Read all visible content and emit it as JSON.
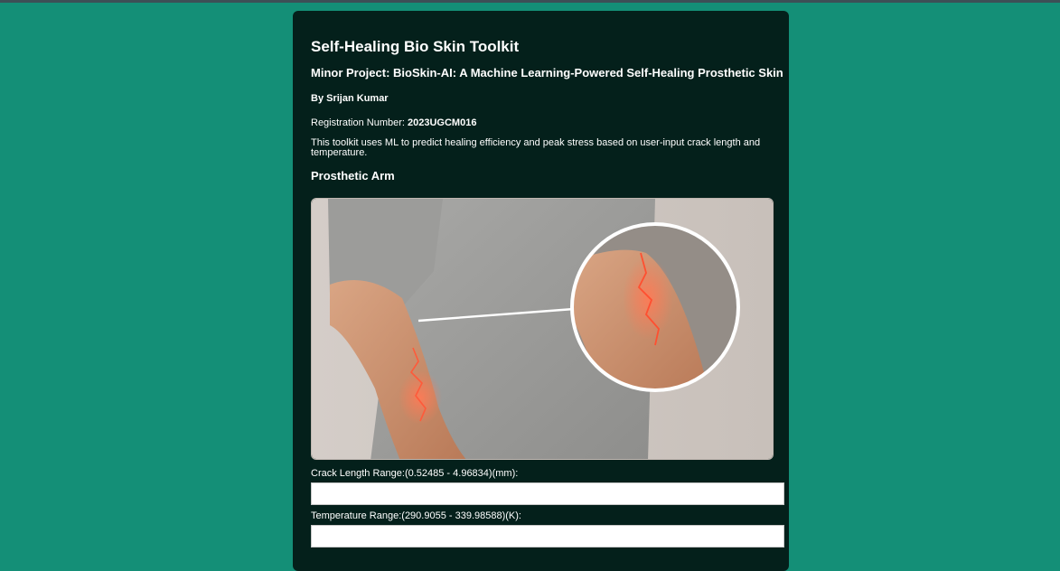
{
  "header": {
    "title": "Self-Healing Bio Skin Toolkit",
    "subtitle": "Minor Project: BioSkin-AI: A Machine Learning-Powered Self-Healing Prosthetic Skin",
    "author_prefix": "By",
    "author_name": "Srijan Kumar",
    "registration_label": "Registration Number:",
    "registration_value": "2023UGCM016",
    "description": "This toolkit uses ML to predict healing efficiency and peak stress based on user-input crack length and temperature."
  },
  "section": {
    "title": "Prosthetic Arm",
    "image_alt": "prosthetic arm with crack and magnified inset"
  },
  "form": {
    "crack_label": "Crack Length Range:(0.52485 - 4.96834)(mm):",
    "crack_value": "",
    "temperature_label": "Temperature Range:(290.9055 - 339.98588)(K):",
    "temperature_value": ""
  },
  "colors": {
    "page_background": "#148f77",
    "card_background": "#04201b",
    "crack_glow": "#ff6a4a"
  }
}
